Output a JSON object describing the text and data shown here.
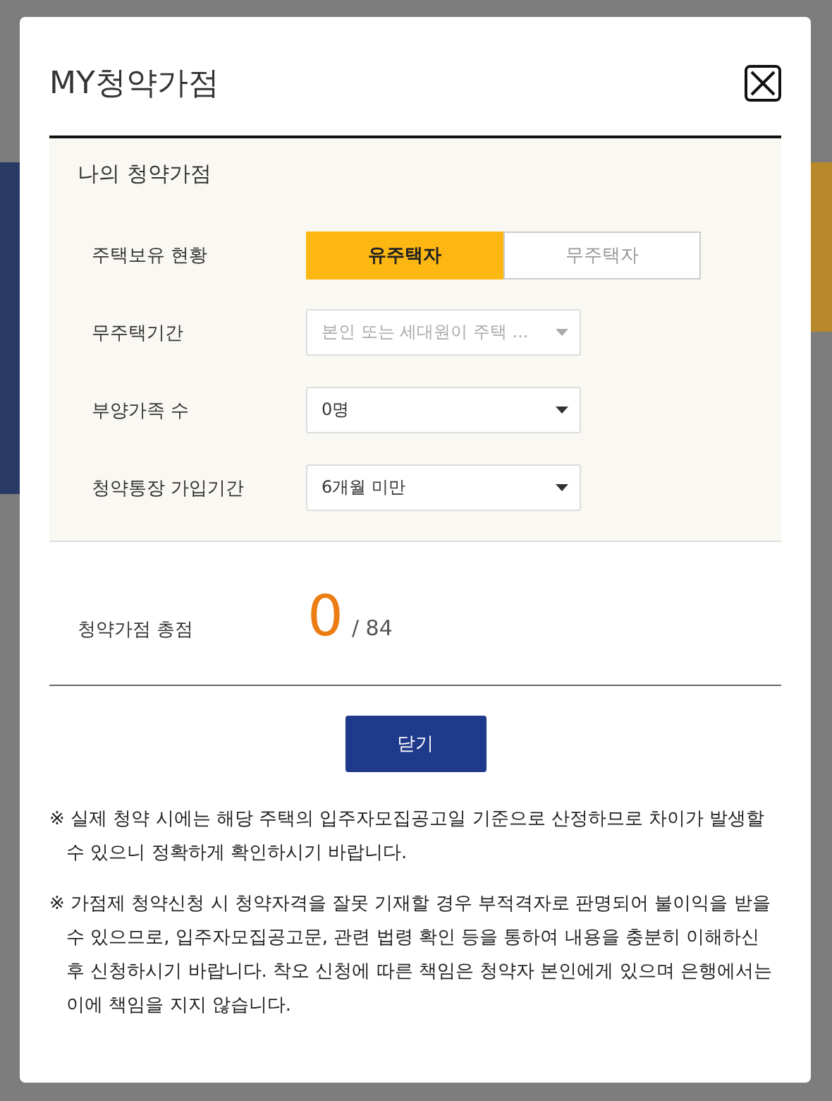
{
  "modal": {
    "title": "MY청약가점"
  },
  "section": {
    "heading": "나의 청약가점",
    "ownership": {
      "label": "주택보유 현황",
      "options": [
        {
          "label": "유주택자",
          "selected": true
        },
        {
          "label": "무주택자",
          "selected": false
        }
      ]
    },
    "fields": [
      {
        "label": "무주택기간",
        "value": "본인 또는 세대원이 주택 ...",
        "disabled": true
      },
      {
        "label": "부양가족 수",
        "value": "0명",
        "disabled": false
      },
      {
        "label": "청약통장 가입기간",
        "value": "6개월 미만",
        "disabled": false
      }
    ]
  },
  "total": {
    "label": "청약가점 총점",
    "score": "0",
    "max": "/ 84"
  },
  "close_button": "닫기",
  "notes": [
    "※ 실제 청약 시에는 해당 주택의 입주자모집공고일 기준으로 산정하므로 차이가 발생할 수 있으니 정확하게 확인하시기 바랍니다.",
    "※ 가점제 청약신청 시 청약자격을 잘못 기재할 경우 부적격자로 판명되어 불이익을 받을 수 있으므로, 입주자모집공고문, 관련 법령 확인 등을 통하여 내용을 충분히 이해하신 후 신청하시기 바랍니다. 착오 신청에 따른 책임은 청약자 본인에게 있으며 은행에서는 이에 책임을 지지 않습니다."
  ]
}
